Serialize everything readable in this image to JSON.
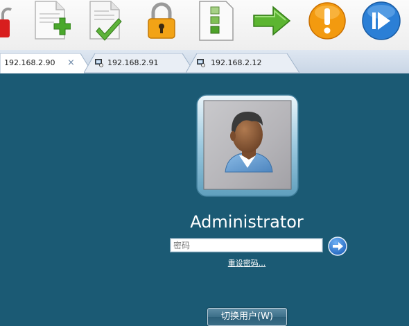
{
  "toolbar": {
    "icons": [
      "unlock-icon",
      "new-document-icon",
      "approved-document-icon",
      "lock-icon",
      "list-document-icon",
      "forward-arrow-icon",
      "warning-icon",
      "play-icon"
    ]
  },
  "tabs": [
    {
      "label": "192.168.2.90",
      "active": true,
      "close": "×"
    },
    {
      "label": "192.168.2.91",
      "active": false
    },
    {
      "label": "192.168.2.12",
      "active": false
    }
  ],
  "login": {
    "username": "Administrator",
    "password_placeholder": "密码",
    "password_value": "",
    "reset_link": "重设密码...",
    "switch_user": "切换用户(W)"
  },
  "colors": {
    "background": "#1b5a74",
    "tabbar": "#c9d6e6",
    "text_light": "#ffffff"
  }
}
